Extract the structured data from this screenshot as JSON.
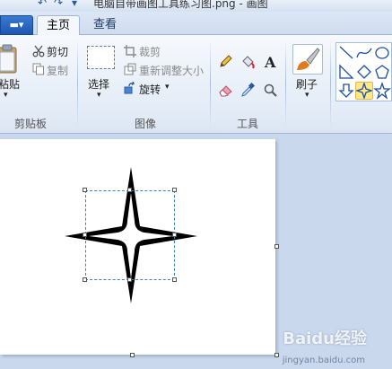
{
  "window": {
    "title": "电脑自带画图工具练习图.png - 画图",
    "file_menu_label": "▬▾"
  },
  "tabs": [
    {
      "label": "主页",
      "active": true
    },
    {
      "label": "查看",
      "active": false
    }
  ],
  "clipboard": {
    "group_label": "剪贴板",
    "paste_label": "粘贴",
    "cut_label": "剪切",
    "copy_label": "复制"
  },
  "image": {
    "group_label": "图像",
    "select_label": "选择",
    "crop_label": "裁剪",
    "resize_label": "重新调整大小",
    "rotate_label": "旋转"
  },
  "tools": {
    "group_label": "工具",
    "items": [
      "pencil-icon",
      "fill-bucket-icon",
      "text-icon",
      "eraser-icon",
      "color-picker-icon",
      "magnifier-icon"
    ]
  },
  "brushes": {
    "label": "刷子"
  },
  "shapes": {
    "items": [
      "line-icon",
      "curve-icon",
      "oval-icon",
      "triangle-icon",
      "polygon-icon",
      "pentagon-icon",
      "arrow-down-icon",
      "four-point-star-icon",
      "five-point-star-icon"
    ],
    "selected": "four-point-star-icon"
  },
  "colors": {
    "ribbon_bg": "#e4ecf7",
    "workspace_bg": "#c9d8ec",
    "canvas_bg": "#ffffff",
    "selection_dash": "#3a7fc8",
    "shape_fill": "#000000"
  },
  "watermark": {
    "brand": "Baidu经验",
    "url": "jingyan.baidu.com"
  }
}
